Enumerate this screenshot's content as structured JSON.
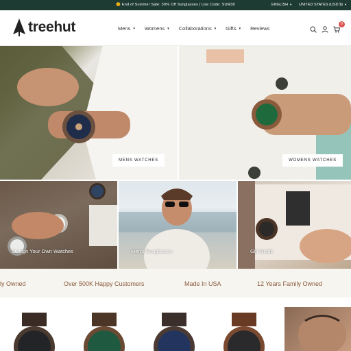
{
  "announcement": {
    "text": "🌞 End of Summer Sale: 30% Off Sunglasses | Use Code: SUM30",
    "language": "ENGLISH",
    "currency": "UNITED STATES (USD $)"
  },
  "header": {
    "logo_text": "treehut",
    "nav": [
      {
        "label": "Mens",
        "dropdown": true
      },
      {
        "label": "Womens",
        "dropdown": true
      },
      {
        "label": "Collaborations",
        "dropdown": true
      },
      {
        "label": "Gifts",
        "dropdown": true
      },
      {
        "label": "Reviews",
        "dropdown": false
      }
    ],
    "icons": [
      "search-icon",
      "account-icon",
      "cart-icon"
    ],
    "cart_count": "0"
  },
  "hero": {
    "left_button": "MENS WATCHES",
    "right_button": "WOMENS WATCHES"
  },
  "tiles": [
    {
      "label": "Design Your Own Watches"
    },
    {
      "label": "Men's Sunglasses"
    },
    {
      "label": "Gift Guide"
    }
  ],
  "trust_strip": [
    "ily Owned",
    "Over 500K Happy Customers",
    "Made In USA",
    "12 Years Family Owned"
  ],
  "colors": {
    "topbar_bg": "#1e3b33",
    "accent_text": "#8b5a3c",
    "badge": "#d9534f"
  }
}
